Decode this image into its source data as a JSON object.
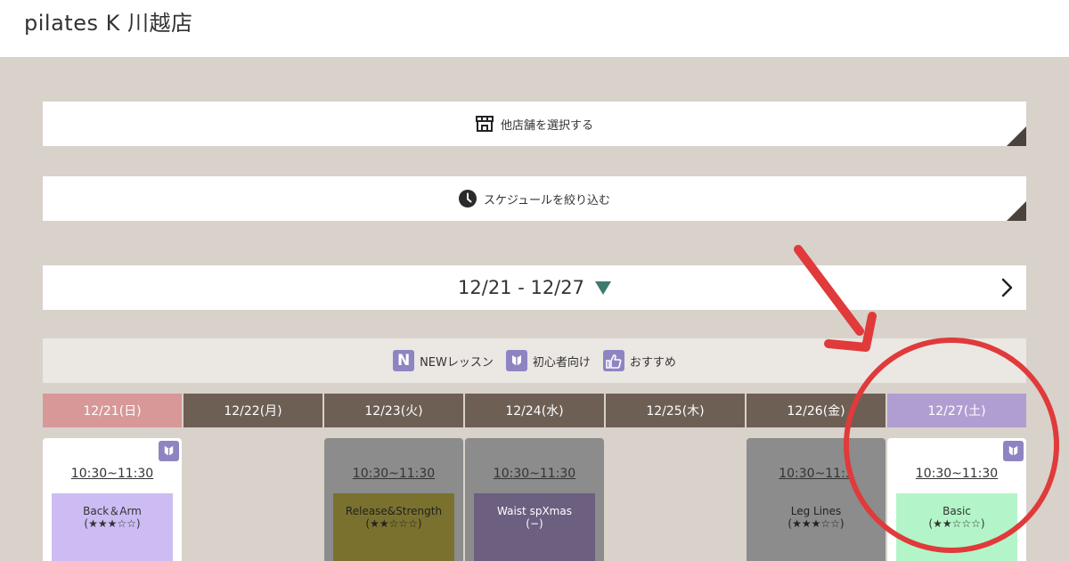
{
  "store": {
    "title": "pilates K 川越店"
  },
  "store_select": {
    "label": "他店舗を選択する",
    "icon": "store-icon"
  },
  "schedule_filter": {
    "label": "スケジュールを絞り込む",
    "icon": "clock-icon"
  },
  "week": {
    "range": "12/21 - 12/27",
    "next_icon": "chevron-right-icon"
  },
  "legend": [
    {
      "badge": "N",
      "label": "NEWレッスン"
    },
    {
      "badge": "",
      "label": "初心者向け"
    },
    {
      "badge": "",
      "label": "おすすめ"
    }
  ],
  "days": [
    {
      "label": "12/21(日)",
      "color": "#d89898"
    },
    {
      "label": "12/22(月)",
      "color": "#6e5f55"
    },
    {
      "label": "12/23(火)",
      "color": "#6e5f55"
    },
    {
      "label": "12/24(水)",
      "color": "#6e5f55"
    },
    {
      "label": "12/25(木)",
      "color": "#6e5f55"
    },
    {
      "label": "12/26(金)",
      "color": "#6e5f55"
    },
    {
      "label": "12/27(土)",
      "color": "#b09ed2"
    }
  ],
  "lessons": [
    {
      "day": 0,
      "time": "10:30~11:30",
      "name": "Back＆Arm",
      "level": "(★★★☆☆)",
      "card_color": "#ffffff",
      "lesson_color": "#cdbcf4",
      "text_color": "#333333",
      "beginner": true
    },
    {
      "day": 2,
      "time": "10:30~11:30",
      "name": "Release&Strength",
      "level": "(★★☆☆☆)",
      "card_color": "#8c8c8c",
      "lesson_color": "#7a712e",
      "text_color": "#222222",
      "beginner": false
    },
    {
      "day": 3,
      "time": "10:30~11:30",
      "name": "Waist spXmas",
      "level": "(−)",
      "card_color": "#8c8c8c",
      "lesson_color": "#6c5f80",
      "text_color": "#ffffff",
      "beginner": false
    },
    {
      "day": 5,
      "time": "10:30~11:3",
      "name": "Leg Lines",
      "level": "(★★★☆☆)",
      "card_color": "#8c8c8c",
      "lesson_color": "#8c8c8c",
      "text_color": "#222222",
      "beginner": false
    },
    {
      "day": 6,
      "time": "10:30~11:30",
      "name": "Basic",
      "level": "(★★☆☆☆)",
      "card_color": "#ffffff",
      "lesson_color": "#b3f5c8",
      "text_color": "#333333",
      "beginner": true
    }
  ],
  "annotation": {
    "arrow_color": "#e03a3a",
    "circle_color": "#e03a3a"
  }
}
